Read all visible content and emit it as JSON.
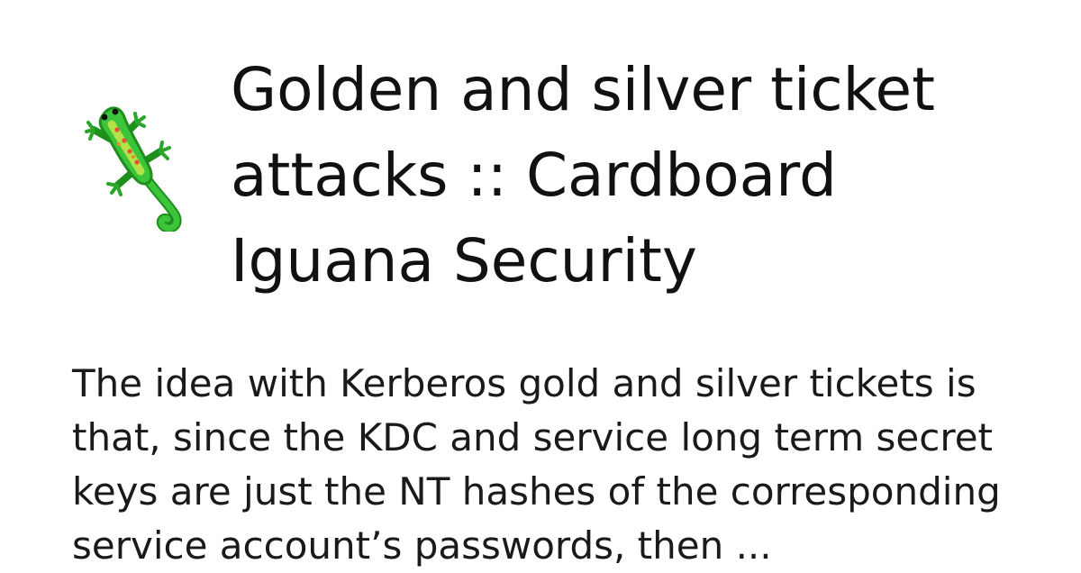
{
  "site": {
    "logo_icon": "lizard-icon",
    "accent_color": "#3cc43a"
  },
  "title": {
    "lines": [
      "Golden and silver ticket",
      "attacks :: Cardboard",
      "Iguana Security"
    ]
  },
  "description": {
    "lines": [
      "The idea with Kerberos gold and silver tickets is",
      "that, since the KDC and service long term secret",
      "keys are just the NT hashes of the corresponding",
      "service account’s passwords, then ..."
    ]
  }
}
